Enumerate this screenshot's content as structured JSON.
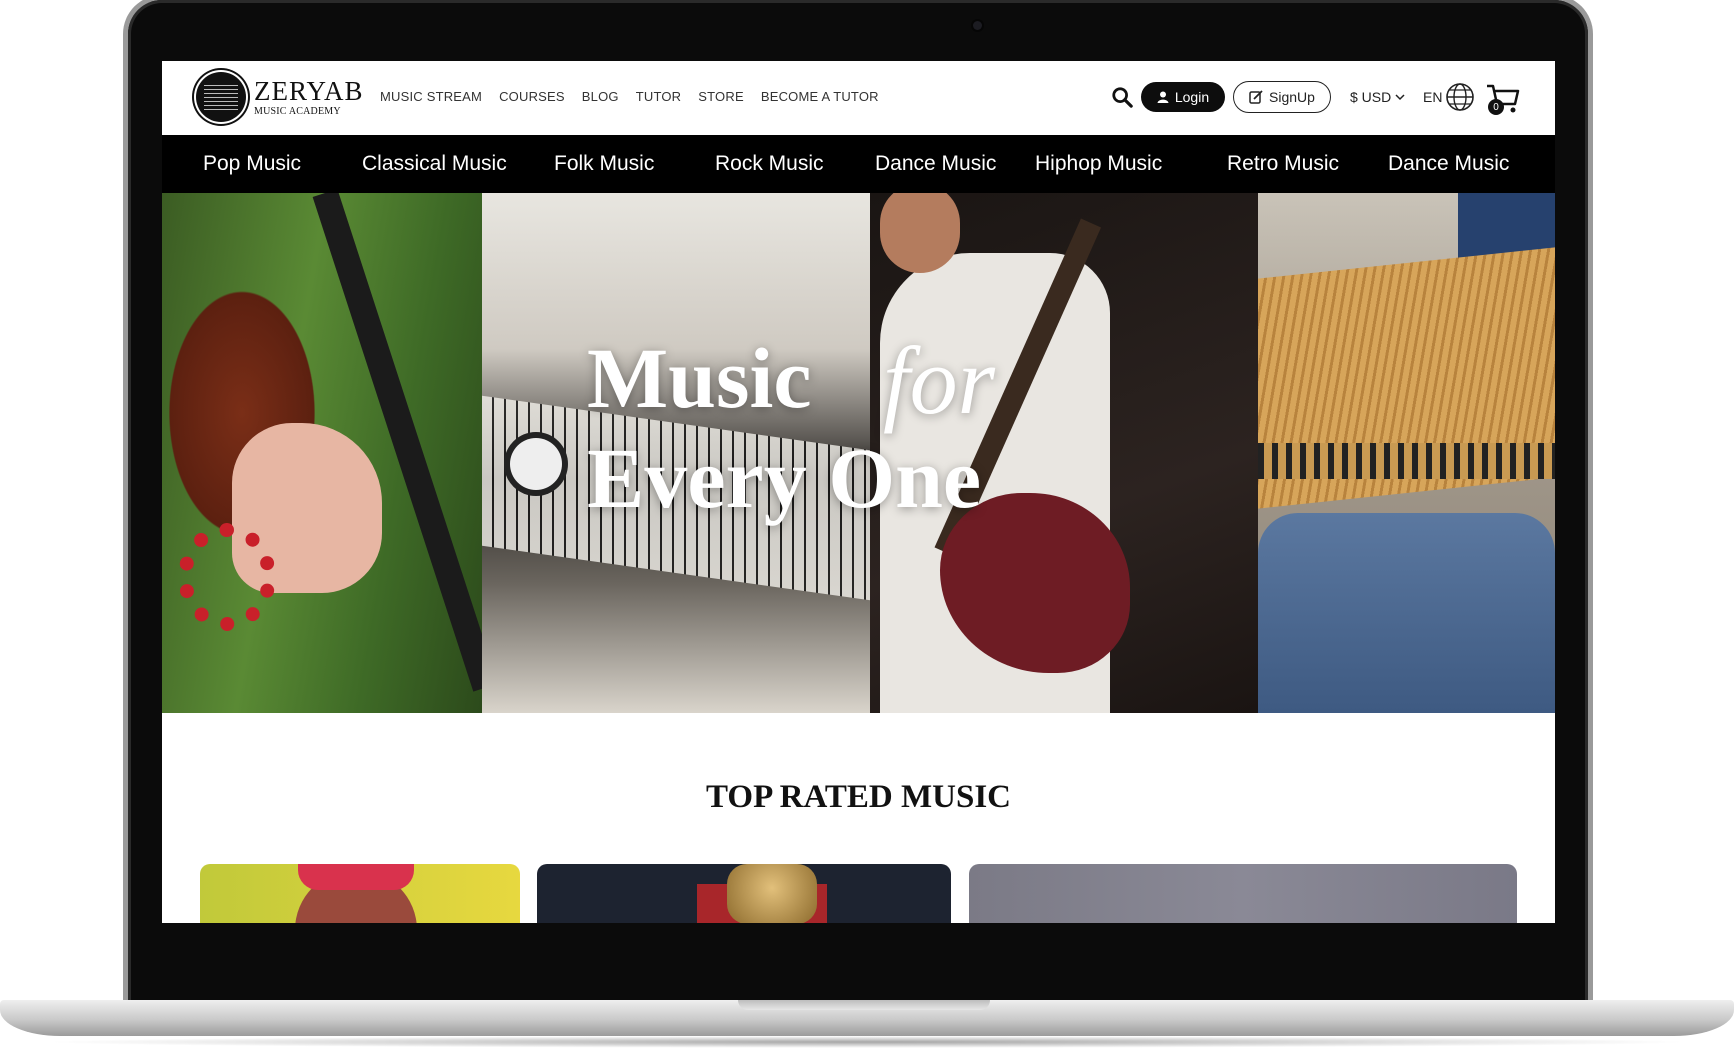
{
  "brand": {
    "name": "ZERYAB",
    "subtitle": "MUSIC ACADEMY"
  },
  "nav": [
    {
      "label": "MUSIC STREAM"
    },
    {
      "label": "COURSES"
    },
    {
      "label": "BLOG"
    },
    {
      "label": "TUTOR"
    },
    {
      "label": "STORE"
    },
    {
      "label": "BECOME A TUTOR"
    }
  ],
  "header": {
    "login_label": "Login",
    "signup_label": "SignUp",
    "currency": "$ USD",
    "language": "EN",
    "cart_count": "0"
  },
  "categories": [
    {
      "label": "Pop Music"
    },
    {
      "label": "Classical Music"
    },
    {
      "label": "Folk Music"
    },
    {
      "label": "Rock Music"
    },
    {
      "label": "Dance Music"
    },
    {
      "label": "Hiphop Music"
    },
    {
      "label": "Retro Music"
    },
    {
      "label": "Dance Music"
    }
  ],
  "hero": {
    "line1": "Music",
    "line1_accent": "for",
    "line2": "Every One"
  },
  "top_rated": {
    "title": "TOP RATED MUSIC"
  },
  "colors": {
    "primary": "#000000",
    "background": "#ffffff",
    "accent_text": "#ffffff"
  },
  "icons": [
    "search-icon",
    "user-icon",
    "edit-icon",
    "chevron-down-icon",
    "globe-icon",
    "cart-icon"
  ]
}
